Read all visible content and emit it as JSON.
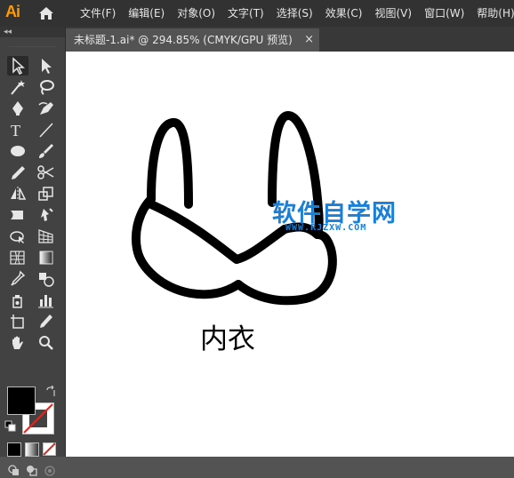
{
  "app": {
    "logo_text": "Ai"
  },
  "menu": {
    "items": [
      {
        "label": "文件(F)"
      },
      {
        "label": "编辑(E)"
      },
      {
        "label": "对象(O)"
      },
      {
        "label": "文字(T)"
      },
      {
        "label": "选择(S)"
      },
      {
        "label": "效果(C)"
      },
      {
        "label": "视图(V)"
      },
      {
        "label": "窗口(W)"
      },
      {
        "label": "帮助(H)"
      }
    ]
  },
  "toolbar": {
    "collapse_label": "◂◂",
    "tools": [
      "selection-tool",
      "direct-selection-tool",
      "magic-wand-tool",
      "lasso-tool",
      "pen-tool",
      "curvature-tool",
      "type-tool",
      "line-segment-tool",
      "ellipse-tool",
      "paintbrush-tool",
      "pencil-tool",
      "scissors-tool",
      "reflect-tool",
      "scale-tool",
      "width-tool",
      "puppet-warp-tool",
      "free-transform-tool",
      "perspective-grid-tool",
      "mesh-tool",
      "gradient-tool",
      "eyedropper-tool",
      "blend-tool",
      "symbol-sprayer-tool",
      "column-graph-tool",
      "artboard-tool",
      "slice-tool",
      "hand-tool",
      "zoom-tool"
    ],
    "fill_color": "#000000",
    "stroke_color": "#ffffff"
  },
  "document": {
    "tab_title": "未标题-1.ai* @ 294.85% (CMYK/GPU 预览)",
    "close_label": "×"
  },
  "artwork": {
    "label": "内衣",
    "stroke_color": "#000000"
  },
  "watermark": {
    "title": "软件自学网",
    "url": "WWW.RJZXW.COM",
    "color": "#1a7fd6"
  }
}
